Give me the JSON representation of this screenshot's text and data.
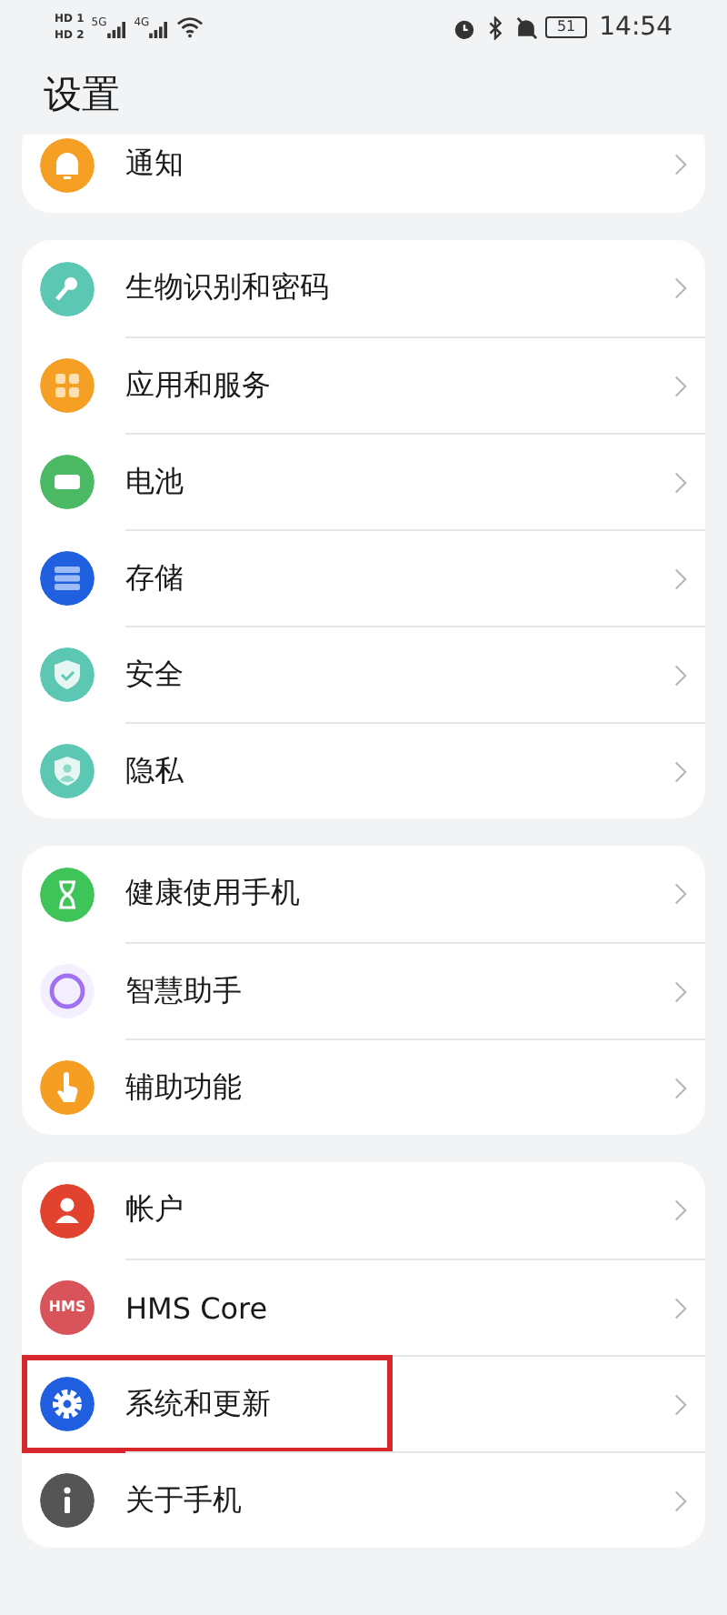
{
  "status_bar": {
    "sims": [
      {
        "label": "HD",
        "slot": "1"
      },
      {
        "label": "HD",
        "slot": "2"
      }
    ],
    "networks": [
      {
        "label": "5G"
      },
      {
        "label": "4G"
      }
    ],
    "battery": "51",
    "time": "14:54"
  },
  "title": "设置",
  "groups": [
    {
      "clipped": true,
      "items": [
        {
          "kind": "bell",
          "label": "通知",
          "highlighted": false
        }
      ]
    },
    {
      "clipped": false,
      "items": [
        {
          "kind": "key",
          "label": "生物识别和密码",
          "highlighted": false
        },
        {
          "kind": "apps",
          "label": "应用和服务",
          "highlighted": false
        },
        {
          "kind": "battery",
          "label": "电池",
          "highlighted": false
        },
        {
          "kind": "storage",
          "label": "存储",
          "highlighted": false
        },
        {
          "kind": "security",
          "label": "安全",
          "highlighted": false
        },
        {
          "kind": "privacy",
          "label": "隐私",
          "highlighted": false
        }
      ]
    },
    {
      "clipped": false,
      "items": [
        {
          "kind": "hourglass",
          "label": "健康使用手机",
          "highlighted": false
        },
        {
          "kind": "ring",
          "label": "智慧助手",
          "highlighted": false
        },
        {
          "kind": "hand",
          "label": "辅助功能",
          "highlighted": false
        }
      ]
    },
    {
      "clipped": false,
      "items": [
        {
          "kind": "account",
          "label": "帐户",
          "highlighted": false
        },
        {
          "kind": "hms",
          "label": "HMS Core",
          "icon_text": "HMS",
          "highlighted": false
        },
        {
          "kind": "gear",
          "label": "系统和更新",
          "highlighted": true
        },
        {
          "kind": "info",
          "label": "关于手机",
          "highlighted": false
        }
      ]
    }
  ]
}
